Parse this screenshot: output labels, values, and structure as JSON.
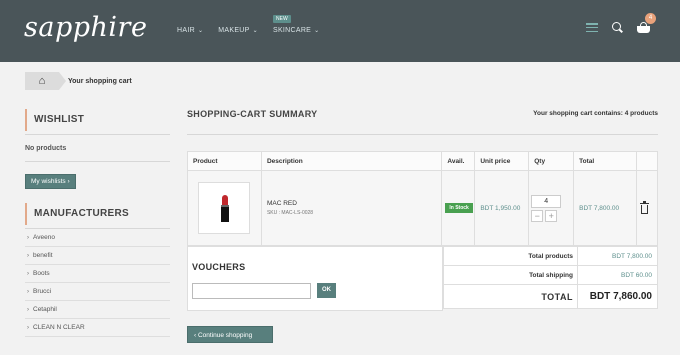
{
  "header": {
    "logo": "sapphire",
    "nav": [
      {
        "label": "HAIR"
      },
      {
        "label": "MAKEUP"
      },
      {
        "label": "SKINCARE",
        "badge": "NEW"
      }
    ],
    "icons": {
      "menu": "hamburger-icon",
      "search": "search-icon",
      "cart": "basket-icon"
    },
    "cart_count": "4"
  },
  "breadcrumb": {
    "home_icon": "home-icon",
    "current": "Your shopping cart"
  },
  "sidebar": {
    "wishlist": {
      "title": "WISHLIST",
      "empty_text": "No products",
      "button": "My wishlists"
    },
    "manufacturers": {
      "title": "MANUFACTURERS",
      "items": [
        "Aveeno",
        "benefit",
        "Boots",
        "Brucci",
        "Cetaphil",
        "CLEAN N CLEAR"
      ]
    }
  },
  "main": {
    "title": "SHOPPING-CART SUMMARY",
    "summary_text": "Your shopping cart contains: 4 products",
    "table": {
      "headers": [
        "Product",
        "Description",
        "Avail.",
        "Unit price",
        "Qty",
        "Total"
      ],
      "rows": [
        {
          "name": "MAC RED",
          "sku": "SKU : MAC-LS-0028",
          "availability": "In Stock",
          "unit_price": "BDT 1,950.00",
          "qty": "4",
          "total": "BDT 7,800.00"
        }
      ]
    },
    "vouchers": {
      "title": "VOUCHERS",
      "input_value": "",
      "button": "OK"
    },
    "totals": {
      "products_label": "Total products",
      "products_value": "BDT 7,800.00",
      "shipping_label": "Total shipping",
      "shipping_value": "BDT 60.00",
      "grand_label": "TOTAL",
      "grand_value": "BDT 7,860.00"
    },
    "continue_button": "Continue shopping"
  },
  "colors": {
    "header_bg": "#4a5559",
    "accent_teal": "#587f7d",
    "accent_peach": "#e2a98a",
    "stock_green": "#49a050"
  }
}
